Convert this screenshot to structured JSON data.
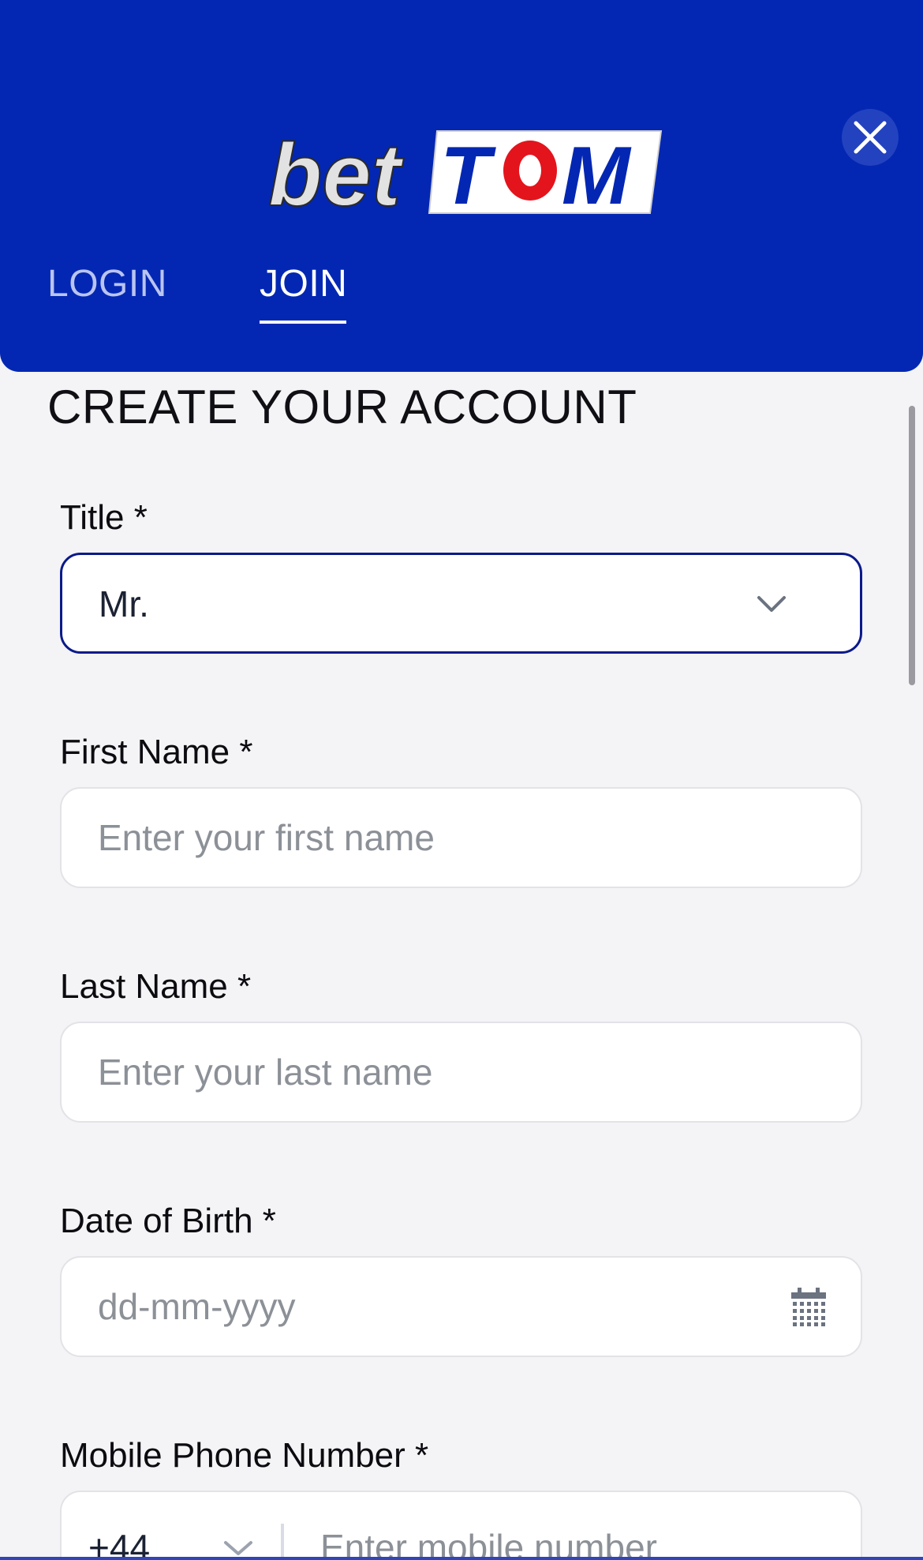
{
  "header": {
    "logo_text_left": "bet",
    "logo_text_right_1": "T",
    "logo_text_right_2": "O",
    "logo_text_right_3": "M",
    "tabs": [
      {
        "label": "LOGIN",
        "active": false
      },
      {
        "label": "JOIN",
        "active": true
      }
    ]
  },
  "form": {
    "title": "CREATE YOUR ACCOUNT",
    "fields": {
      "title": {
        "label": "Title *",
        "value": "Mr."
      },
      "first_name": {
        "label": "First Name *",
        "placeholder": "Enter your first name"
      },
      "last_name": {
        "label": "Last Name *",
        "placeholder": "Enter your last name"
      },
      "dob": {
        "label": "Date of Birth *",
        "placeholder": "dd-mm-yyyy"
      },
      "mobile": {
        "label": "Mobile Phone Number *",
        "country_code": "+44",
        "placeholder": "Enter mobile number"
      }
    }
  },
  "colors": {
    "brand_blue": "#0327b2",
    "logo_red": "#e4141c",
    "focus_border": "#0a1a8a"
  },
  "icons": {
    "close": "close-icon",
    "title_select": "chevron-down-icon",
    "dob": "calendar-icon",
    "country_code": "chevron-down-icon"
  }
}
